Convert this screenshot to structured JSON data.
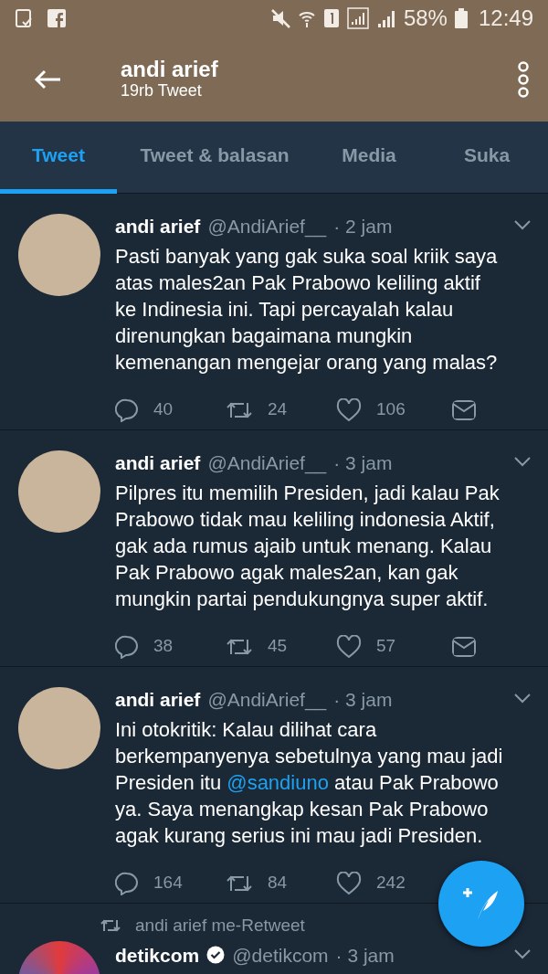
{
  "status_bar": {
    "battery": "58%",
    "time": "12:49"
  },
  "header": {
    "title": "andi arief",
    "subtitle": "19rb Tweet"
  },
  "tabs": [
    {
      "label": "Tweet",
      "selected": true
    },
    {
      "label": "Tweet & balasan",
      "selected": false
    },
    {
      "label": "Media",
      "selected": false
    },
    {
      "label": "Suka",
      "selected": false
    }
  ],
  "tweets": [
    {
      "name": "andi arief",
      "verified": false,
      "handle": "@AndiArief__",
      "time": "· 2 jam",
      "text": [
        {
          "kind": "plain",
          "text": "Pasti banyak yang gak suka soal kriik saya atas males2an Pak Prabowo keliling aktif ke Indinesia ini. Tapi percayalah kalau direnungkan bagaimana mungkin kemenangan mengejar orang yang malas?"
        }
      ],
      "replies": "40",
      "retweets": "24",
      "likes": "106"
    },
    {
      "name": "andi arief",
      "verified": false,
      "handle": "@AndiArief__",
      "time": "· 3 jam",
      "text": [
        {
          "kind": "plain",
          "text": "Pilpres itu memilih Presiden, jadi kalau Pak Prabowo tidak mau keliling indonesia Aktif, gak ada rumus ajaib untuk menang. Kalau Pak Prabowo agak males2an, kan gak mungkin partai pendukungnya super aktif."
        }
      ],
      "replies": "38",
      "retweets": "45",
      "likes": "57"
    },
    {
      "name": "andi arief",
      "verified": false,
      "handle": "@AndiArief__",
      "time": "· 3 jam",
      "text": [
        {
          "kind": "plain",
          "text": "Ini otokritik: Kalau dilihat cara berkempanyenya sebetulnya yang mau jadi Presiden itu "
        },
        {
          "kind": "mention",
          "text": "@sandiuno"
        },
        {
          "kind": "plain",
          "text": " atau Pak Prabowo ya. Saya menangkap kesan Pak Prabowo agak kurang serius ini mau jadi Presiden."
        }
      ],
      "replies": "164",
      "retweets": "84",
      "likes": "242"
    },
    {
      "retweeted_by": "andi arief me-Retweet",
      "name": "detikcom",
      "verified": true,
      "handle": "@detikcom",
      "time": "· 3 jam"
    }
  ]
}
